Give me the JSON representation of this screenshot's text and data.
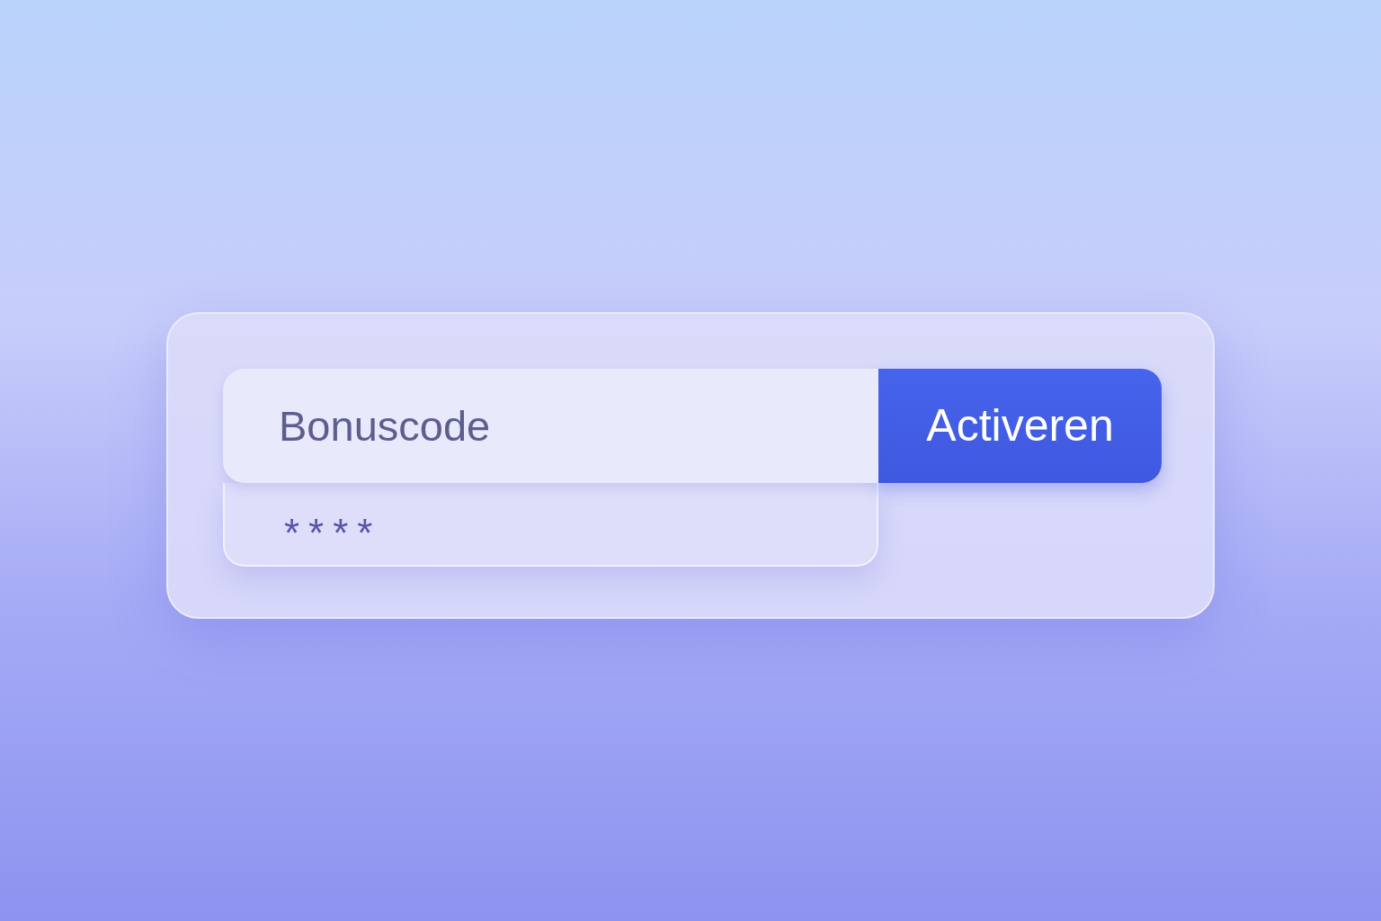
{
  "bonus_form": {
    "code_field": {
      "placeholder": "Bonuscode"
    },
    "dropdown": {
      "masked_code": "****"
    },
    "button": {
      "label": "Activeren"
    }
  }
}
